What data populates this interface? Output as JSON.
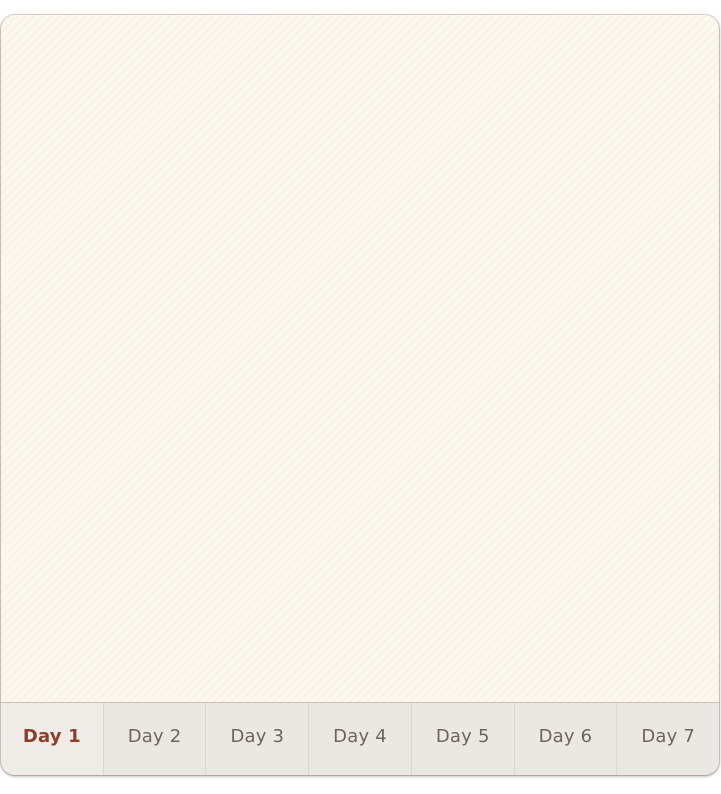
{
  "tabs": {
    "items": [
      {
        "label": "Day 1",
        "active": true
      },
      {
        "label": "Day 2",
        "active": false
      },
      {
        "label": "Day 3",
        "active": false
      },
      {
        "label": "Day 4",
        "active": false
      },
      {
        "label": "Day 5",
        "active": false
      },
      {
        "label": "Day 6",
        "active": false
      },
      {
        "label": "Day 7",
        "active": false
      }
    ]
  },
  "colors": {
    "panel_background": "#fcf8ee",
    "tabbar_background": "#ebe8e3",
    "active_tab_text": "#8a3f2c",
    "inactive_tab_text": "#6b6560"
  }
}
